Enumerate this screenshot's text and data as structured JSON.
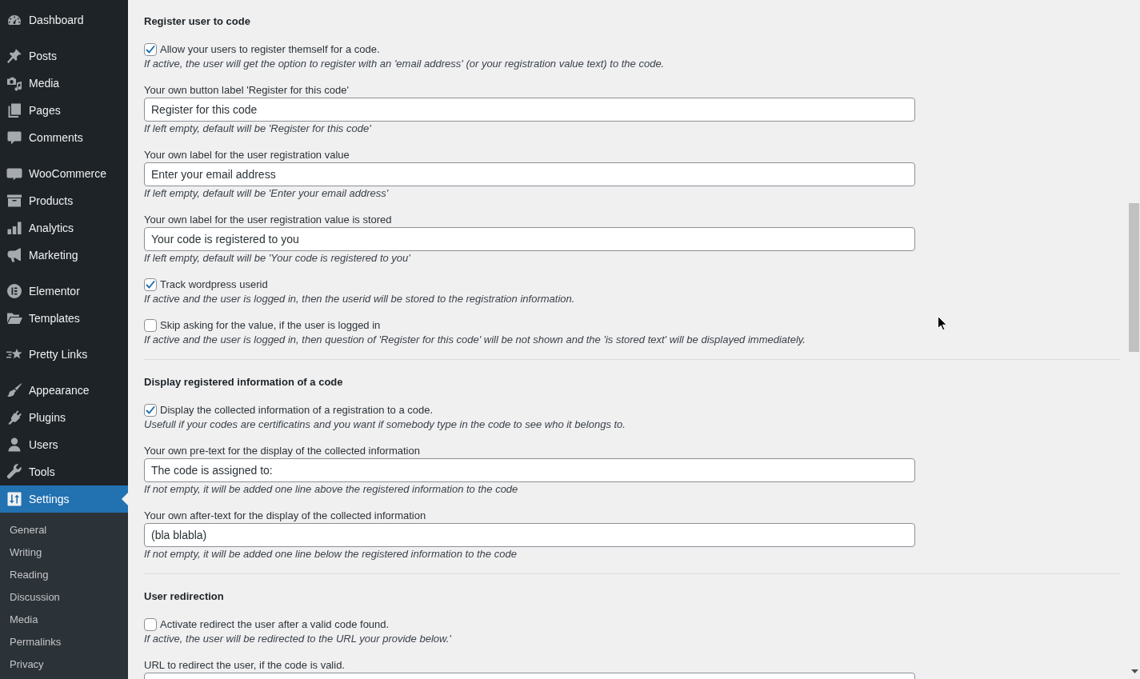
{
  "sidebar": {
    "groups": [
      {
        "items": [
          {
            "label": "Dashboard",
            "selected": false
          }
        ]
      },
      {
        "items": [
          {
            "label": "Posts",
            "selected": false
          },
          {
            "label": "Media",
            "selected": false
          },
          {
            "label": "Pages",
            "selected": false
          },
          {
            "label": "Comments",
            "selected": false
          }
        ]
      },
      {
        "items": [
          {
            "label": "WooCommerce",
            "selected": false
          },
          {
            "label": "Products",
            "selected": false
          },
          {
            "label": "Analytics",
            "selected": false
          },
          {
            "label": "Marketing",
            "selected": false
          }
        ]
      },
      {
        "items": [
          {
            "label": "Elementor",
            "selected": false
          },
          {
            "label": "Templates",
            "selected": false
          }
        ]
      },
      {
        "items": [
          {
            "label": "Pretty Links",
            "selected": false
          }
        ]
      },
      {
        "items": [
          {
            "label": "Appearance",
            "selected": false
          },
          {
            "label": "Plugins",
            "selected": false
          },
          {
            "label": "Users",
            "selected": false
          },
          {
            "label": "Tools",
            "selected": false
          },
          {
            "label": "Settings",
            "selected": true,
            "submenu": [
              {
                "label": "General",
                "selected": false
              },
              {
                "label": "Writing",
                "selected": false
              },
              {
                "label": "Reading",
                "selected": false
              },
              {
                "label": "Discussion",
                "selected": false
              },
              {
                "label": "Media",
                "selected": false
              },
              {
                "label": "Permalinks",
                "selected": false
              },
              {
                "label": "Privacy",
                "selected": false
              }
            ]
          }
        ]
      }
    ]
  },
  "content": {
    "sections": [
      {
        "title": "Register user to code",
        "fields": [
          {
            "kind": "checkbox",
            "label": "Allow your users to register themself for a code.",
            "checked": true,
            "description": "If active, the user will get the option to register with an 'email address' (or your registration value text) to the code."
          },
          {
            "kind": "text",
            "label": "Your own button label 'Register for this code'",
            "value": "Register for this code",
            "description": "If left empty, default will be 'Register for this code'"
          },
          {
            "kind": "text",
            "label": "Your own label for the user registration value",
            "value": "Enter your email address",
            "description": "If left empty, default will be 'Enter your email address'"
          },
          {
            "kind": "text",
            "label": "Your own label for the user registration value is stored",
            "value": "Your code is registered to you",
            "description": "If left empty, default will be 'Your code is registered to you'"
          },
          {
            "kind": "checkbox",
            "label": "Track wordpress userid",
            "checked": true,
            "description": "If active and the user is logged in, then the userid will be stored to the registration information."
          },
          {
            "kind": "checkbox",
            "label": "Skip asking for the value, if the user is logged in",
            "checked": false,
            "description": "If active and the user is logged in, then question of 'Register for this code' will be not shown and the 'is stored text' will be displayed immediately."
          }
        ]
      },
      {
        "title": "Display registered information of a code",
        "fields": [
          {
            "kind": "checkbox",
            "label": "Display the collected information of a registration to a code.",
            "checked": true,
            "description": "Usefull if your codes are certificatins and you want if somebody type in the code to see who it belongs to."
          },
          {
            "kind": "text",
            "label": "Your own pre-text for the display of the collected information",
            "value": "The code is assigned to:",
            "description": "If not empty, it will be added one line above the registered information to the code"
          },
          {
            "kind": "text",
            "label": "Your own after-text for the display of the collected information",
            "value": "(bla blabla)",
            "description": "If not empty, it will be added one line below the registered information to the code"
          }
        ]
      },
      {
        "title": "User redirection",
        "fields": [
          {
            "kind": "checkbox",
            "label": "Activate redirect the user after a valid code found.",
            "checked": false,
            "description": "If active, the user will be redirected to the URL your provide below.'"
          },
          {
            "kind": "text",
            "label": "URL to redirect the user, if the code is valid."
          }
        ]
      }
    ]
  }
}
